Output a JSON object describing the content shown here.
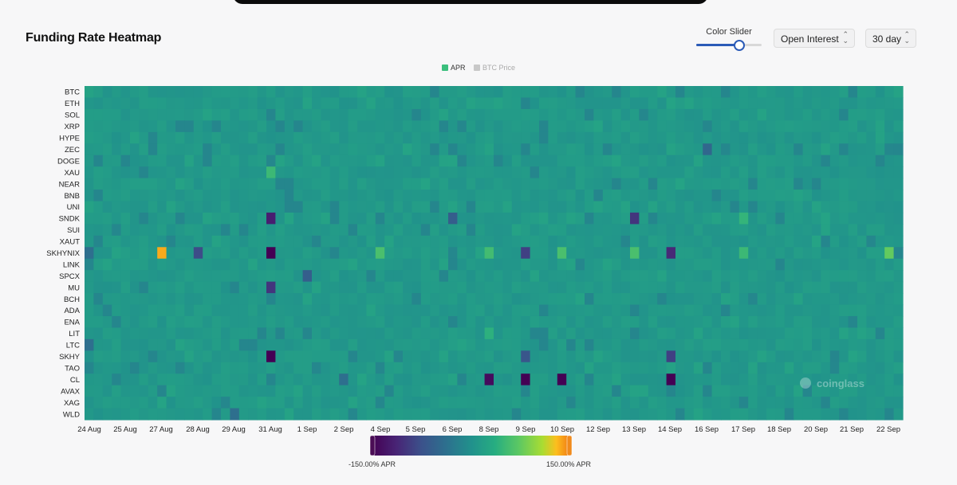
{
  "page": {
    "title": "Funding Rate Heatmap"
  },
  "controls": {
    "slider_label": "Color Slider",
    "slider_value": 0.66,
    "accent": "#2b5bb7",
    "metric_select": "Open Interest",
    "range_select": "30 day"
  },
  "watermark": "coinglass",
  "colorbar": {
    "min_label": "-150.00% APR",
    "max_label": "150.00% APR"
  },
  "chart_data": {
    "type": "heatmap",
    "title": "Funding Rate Heatmap",
    "legend": [
      {
        "name": "APR",
        "color": "#3bbf7d",
        "active": true
      },
      {
        "name": "BTC Price",
        "color": "#c8c8c8",
        "active": false
      }
    ],
    "y_categories": [
      "BTC",
      "ETH",
      "SOL",
      "XRP",
      "HYPE",
      "ZEC",
      "DOGE",
      "XAU",
      "NEAR",
      "BNB",
      "UNI",
      "SNDK",
      "SUI",
      "XAUT",
      "SKHYNIX",
      "LINK",
      "SPCX",
      "MU",
      "BCH",
      "ADA",
      "ENA",
      "LIT",
      "LTC",
      "SKHY",
      "TAO",
      "CL",
      "AVAX",
      "XAG",
      "WLD"
    ],
    "x_tick_labels": [
      "24 Aug",
      "25 Aug",
      "27 Aug",
      "28 Aug",
      "29 Aug",
      "31 Aug",
      "1 Sep",
      "2 Sep",
      "4 Sep",
      "5 Sep",
      "6 Sep",
      "8 Sep",
      "9 Sep",
      "10 Sep",
      "12 Sep",
      "13 Sep",
      "14 Sep",
      "16 Sep",
      "17 Sep",
      "18 Sep",
      "20 Sep",
      "21 Sep",
      "22 Sep"
    ],
    "value_range": [
      -150,
      150
    ],
    "value_unit": "% APR",
    "baseline_value": 10,
    "highlights": [
      {
        "row": "SKHYNIX",
        "date": "27 Aug",
        "value": 135
      },
      {
        "row": "SKHYNIX",
        "date": "31 Aug",
        "value": -150
      },
      {
        "row": "SNDK",
        "date": "31 Aug",
        "value": -120
      },
      {
        "row": "MU",
        "date": "31 Aug",
        "value": -100
      },
      {
        "row": "SKHY",
        "date": "31 Aug",
        "value": -150
      },
      {
        "row": "SKHYNIX",
        "date": "24 Aug",
        "value": -40
      },
      {
        "row": "SKHYNIX",
        "date": "28 Aug",
        "value": -80
      },
      {
        "row": "SKHYNIX",
        "date": "4 Sep",
        "value": 60
      },
      {
        "row": "SKHYNIX",
        "date": "8 Sep",
        "value": 55
      },
      {
        "row": "SKHYNIX",
        "date": "9 Sep",
        "value": -90
      },
      {
        "row": "SKHYNIX",
        "date": "10 Sep",
        "value": 60
      },
      {
        "row": "SKHYNIX",
        "date": "13 Sep",
        "value": 60
      },
      {
        "row": "SKHYNIX",
        "date": "14 Sep",
        "value": -110
      },
      {
        "row": "SKHYNIX",
        "date": "17 Sep",
        "value": 50
      },
      {
        "row": "SKHYNIX",
        "date": "22 Sep",
        "value": 75
      },
      {
        "row": "XAU",
        "date": "31 Aug",
        "value": 50
      },
      {
        "row": "SNDK",
        "date": "6 Sep",
        "value": -60
      },
      {
        "row": "SNDK",
        "date": "13 Sep",
        "value": -100
      },
      {
        "row": "SNDK",
        "date": "17 Sep",
        "value": 45
      },
      {
        "row": "ZEC",
        "date": "16 Sep",
        "value": -50
      },
      {
        "row": "SPCX",
        "date": "1 Sep",
        "value": -60
      },
      {
        "row": "SKHY",
        "date": "9 Sep",
        "value": -70
      },
      {
        "row": "SKHY",
        "date": "14 Sep",
        "value": -90
      },
      {
        "row": "CL",
        "date": "8 Sep",
        "value": -140
      },
      {
        "row": "CL",
        "date": "9 Sep",
        "value": -150
      },
      {
        "row": "CL",
        "date": "10 Sep",
        "value": -150
      },
      {
        "row": "CL",
        "date": "14 Sep",
        "value": -150
      },
      {
        "row": "CL",
        "date": "2 Sep",
        "value": -40
      },
      {
        "row": "LIT",
        "date": "8 Sep",
        "value": 40
      },
      {
        "row": "LTC",
        "date": "24 Aug",
        "value": -40
      },
      {
        "row": "WLD",
        "date": "29 Aug",
        "value": -40
      }
    ]
  }
}
